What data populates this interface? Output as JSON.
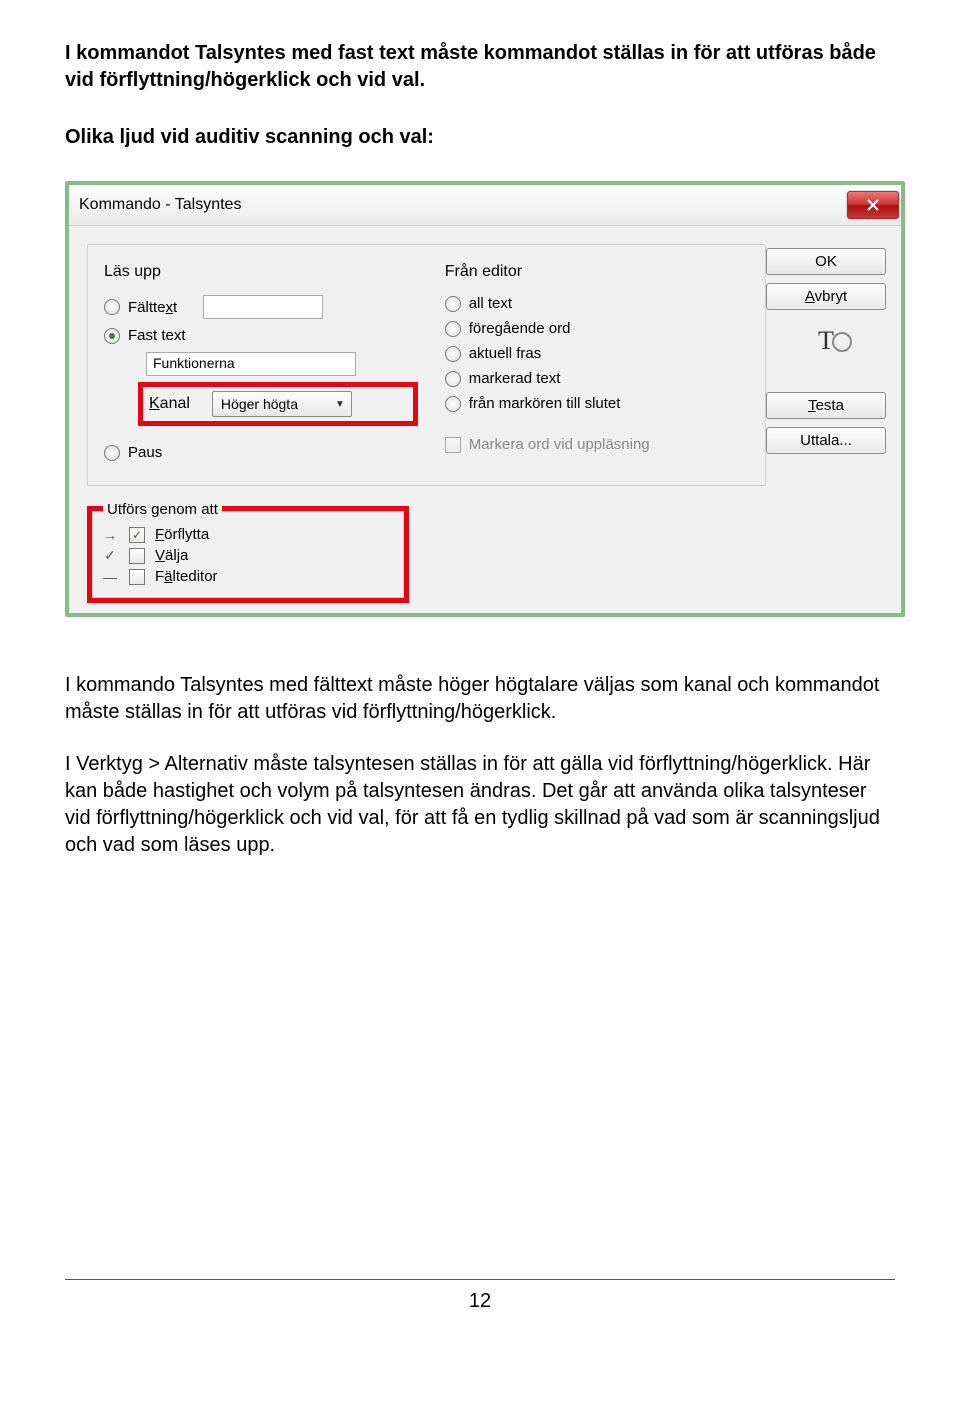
{
  "intro_para": "I kommandot Talsyntes med fast text måste kommandot ställas in för att utföras både vid förflyttning/högerklick och vid val.",
  "heading2": "Olika ljud vid auditiv scanning och val:",
  "dialog": {
    "title": "Kommando - Talsyntes",
    "buttons": {
      "ok": "OK",
      "cancel": "Avbryt",
      "test": "Testa",
      "pronounce": "Uttala..."
    },
    "left": {
      "label": "Läs upp",
      "r_falttext": "Fälttext",
      "r_fasttext": "Fast text",
      "fasttext_value": "Funktionerna",
      "kanal_label": "Kanal",
      "kanal_value": "Höger högta",
      "r_paus": "Paus"
    },
    "right": {
      "label": "Från editor",
      "r_all": "all text",
      "r_foreg": "föregående ord",
      "r_aktuell": "aktuell fras",
      "r_markerad": "markerad text",
      "r_franmark": "från markören till slutet",
      "chk_markera": "Markera ord vid uppläsning"
    },
    "group2": {
      "legend": "Utförs genom att",
      "forflytta": "Förflytta",
      "valja": "Välja",
      "falteditor": "Fälteditor"
    }
  },
  "after1": "I kommando Talsyntes med fälttext måste höger högtalare väljas som kanal och kommandot måste ställas in för att utföras vid förflyttning/högerklick.",
  "after2": "I Verktyg > Alternativ måste talsyntesen ställas in för att gälla vid förflyttning/högerklick. Här kan både hastighet och volym på talsyntesen ändras. Det går att använda olika talsynteser vid förflyttning/högerklick och vid val, för att få en tydlig skillnad på vad som är scanningsljud och vad som läses upp.",
  "page_number": "12"
}
